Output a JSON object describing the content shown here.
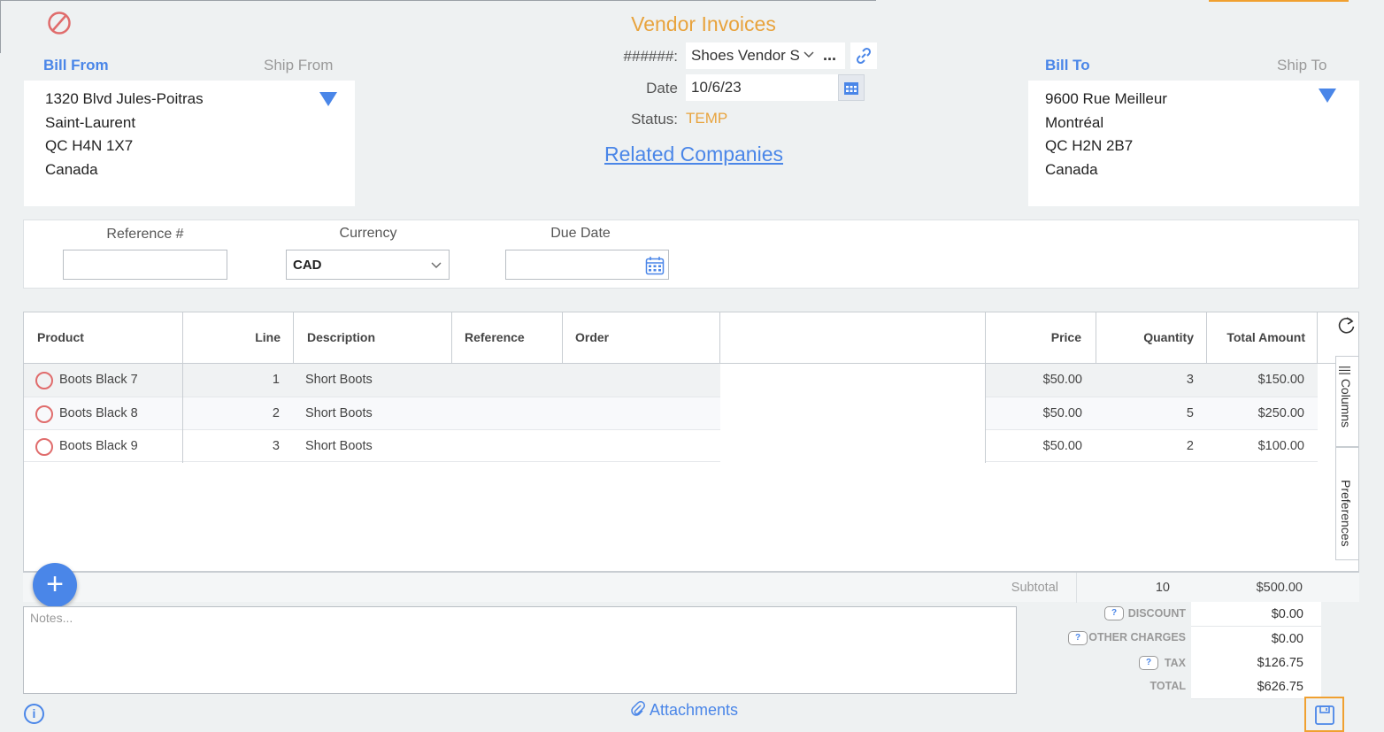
{
  "page": {
    "title": "Vendor Invoices"
  },
  "address": {
    "bill_from_label": "Bill From",
    "ship_from_label": "Ship From",
    "bill_to_label": "Bill To",
    "ship_to_label": "Ship To",
    "from_lines": [
      "1320 Blvd Jules-Poitras",
      "Saint-Laurent",
      "QC H4N 1X7",
      "Canada"
    ],
    "to_lines": [
      "9600 Rue Meilleur",
      "Montréal",
      "QC H2N 2B7",
      "Canada"
    ]
  },
  "header": {
    "vendor_label": "######:",
    "vendor_value": "Shoes Vendor S",
    "more_label": "...",
    "date_label": "Date",
    "date_value": "10/6/23",
    "status_label": "Status:",
    "status_value": "TEMP",
    "related_link": "Related Companies"
  },
  "fields": {
    "reference_label": "Reference #",
    "reference_value": "",
    "currency_label": "Currency",
    "currency_value": "CAD",
    "due_date_label": "Due Date",
    "due_date_value": ""
  },
  "grid": {
    "columns": [
      "Product",
      "Line",
      "Description",
      "Reference",
      "Order",
      "Price",
      "Quantity",
      "Total Amount"
    ],
    "rows": [
      {
        "product": "Boots Black 7",
        "line": "1",
        "description": "Short Boots",
        "reference": "",
        "order": "",
        "price": "$50.00",
        "quantity": "3",
        "total": "$150.00"
      },
      {
        "product": "Boots Black 8",
        "line": "2",
        "description": "Short Boots",
        "reference": "",
        "order": "",
        "price": "$50.00",
        "quantity": "5",
        "total": "$250.00"
      },
      {
        "product": "Boots Black 9",
        "line": "3",
        "description": "Short Boots",
        "reference": "",
        "order": "",
        "price": "$50.00",
        "quantity": "2",
        "total": "$100.00"
      }
    ],
    "side_tabs": {
      "columns": "Columns",
      "preferences": "Preferences"
    }
  },
  "subtotal": {
    "label": "Subtotal",
    "quantity": "10",
    "amount": "$500.00"
  },
  "notes": {
    "placeholder": "Notes..."
  },
  "totals": {
    "discount_label": "DISCOUNT",
    "discount_value": "$0.00",
    "other_label": "OTHER CHARGES",
    "other_value": "$0.00",
    "tax_label": "TAX",
    "tax_value": "$126.75",
    "total_label": "TOTAL",
    "total_value": "$626.75",
    "help_glyph": "?"
  },
  "footer": {
    "attachments_label": "Attachments",
    "info_glyph": "i"
  },
  "colors": {
    "accent_blue": "#4a86e8",
    "accent_orange": "#e8a33d",
    "void_red": "#e06c6c"
  },
  "icons": [
    "void-icon",
    "link-icon",
    "calendar-icon",
    "refresh-icon",
    "plus-icon",
    "paperclip-icon",
    "save-icon",
    "info-icon",
    "help-icon",
    "dropdown-triangle-icon"
  ]
}
